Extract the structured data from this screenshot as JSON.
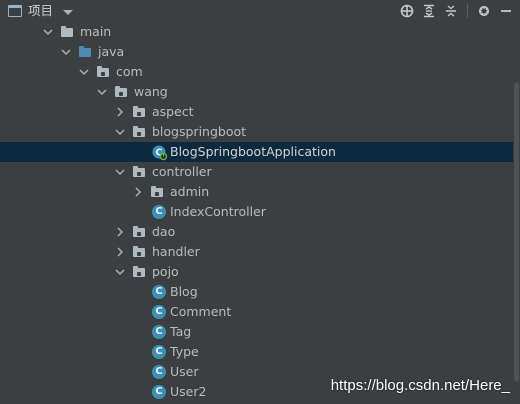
{
  "toolbar": {
    "title": "项目",
    "icons": [
      "project-icon",
      "dropdown-icon",
      "locate-icon",
      "expand-all-icon",
      "collapse-all-icon",
      "gear-icon",
      "hide-icon"
    ]
  },
  "tree": {
    "main": "main",
    "java": "java",
    "com": "com",
    "wang": "wang",
    "aspect": "aspect",
    "blogspringboot": "blogspringboot",
    "app": "BlogSpringbootApplication",
    "controller": "controller",
    "admin": "admin",
    "indexController": "IndexController",
    "dao": "dao",
    "handler": "handler",
    "pojo": "pojo",
    "blog": "Blog",
    "comment": "Comment",
    "tag": "Tag",
    "type": "Type",
    "user": "User",
    "user2": "User2"
  },
  "colors": {
    "background": "#3c3f41",
    "selection": "#0d293e",
    "class_icon": "#3d8fb6",
    "source_folder": "#4f8ab0"
  },
  "watermark": "https://blog.csdn.net/Here_"
}
